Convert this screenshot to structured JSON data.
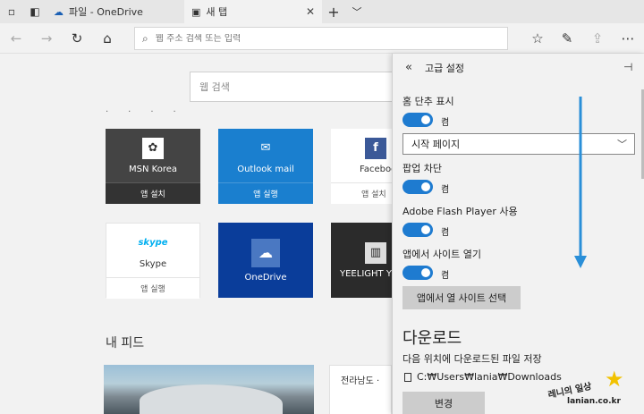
{
  "tabs": [
    {
      "label": "파일 - OneDrive",
      "icon": "cloud-icon"
    },
    {
      "label": "새 탭",
      "icon": "new-tab-icon"
    }
  ],
  "address_bar": {
    "placeholder": "웹 주소 검색 또는 입력"
  },
  "page": {
    "search_placeholder": "웹 검색",
    "tiles": [
      {
        "name": "MSN Korea",
        "action": "앱 설치",
        "bg": "#444444",
        "footer_bg": "#333333",
        "text": "#ffffff",
        "logo": "msn-butterfly-icon"
      },
      {
        "name": "Outlook mail",
        "action": "앱 실행",
        "bg": "#1a7fcf",
        "footer_bg": "#1a7fcf",
        "text": "#ffffff",
        "logo": "outlook-icon"
      },
      {
        "name": "Faceboo",
        "action": "앱 설치",
        "bg": "#ffffff",
        "footer_bg": "#ffffff",
        "text": "#333333",
        "logo": "facebook-icon"
      },
      {
        "name": "Skype",
        "action": "앱 실행",
        "bg": "#ffffff",
        "footer_bg": "#ffffff",
        "text": "#333333",
        "logo": "skype-icon"
      },
      {
        "name": "OneDrive",
        "action": "",
        "bg": "#0a3d9a",
        "footer_bg": "#0a3d9a",
        "text": "#ffffff",
        "logo": "onedrive-icon"
      },
      {
        "name": "YEELIGHT YLD",
        "action": "",
        "bg": "#2b2b2b",
        "footer_bg": "#2b2b2b",
        "text": "#ffffff",
        "logo": "yeelight-icon"
      }
    ],
    "feed_title": "내 피드",
    "feed_card_text": "전라남도 ·"
  },
  "panel": {
    "title": "고급 설정",
    "home_button_label": "홈 단추 표시",
    "toggle_on": "켬",
    "home_select_value": "시작 페이지",
    "popup_label": "팝업 차단",
    "flash_label": "Adobe Flash Player 사용",
    "open_in_apps_label": "앱에서 사이트 열기",
    "choose_apps_button": "앱에서 열 사이트 선택",
    "downloads_heading": "다운로드",
    "save_location_label": "다음 위치에 다운로드된 파일 저장",
    "download_path": "C:₩Users₩lania₩Downloads",
    "change_button": "변경"
  },
  "watermark": {
    "text": "레니의 일상",
    "url": "lanian.co.kr"
  },
  "colors": {
    "accent": "#1e7bd0",
    "arrow": "#2a8fd8"
  }
}
